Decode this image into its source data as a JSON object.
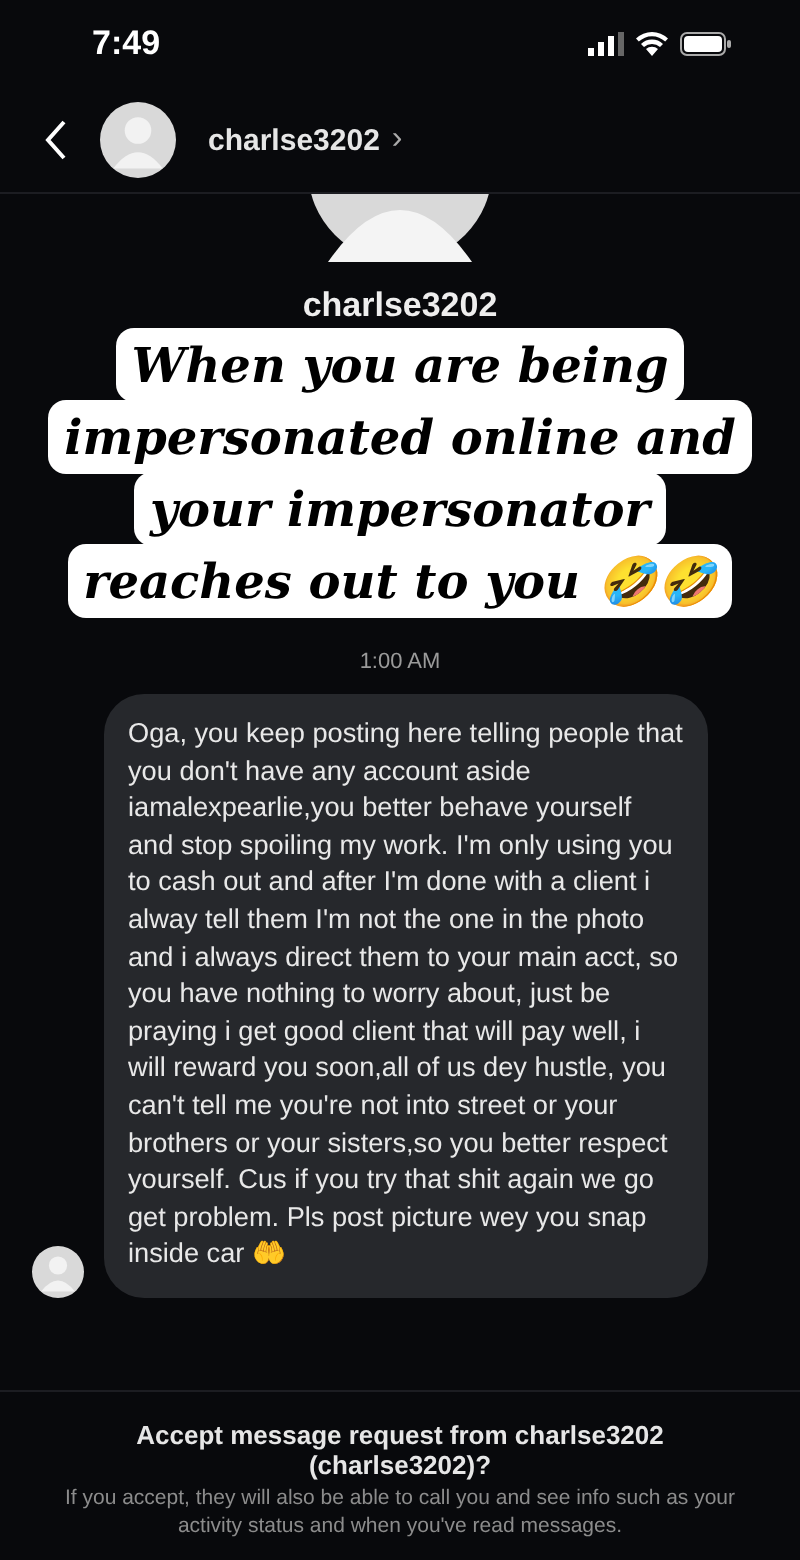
{
  "status_bar": {
    "time": "7:49"
  },
  "header": {
    "username": "charlse3202",
    "chevron": "›"
  },
  "profile": {
    "username": "charlse3202"
  },
  "caption": {
    "lines": [
      "When you are being",
      "impersonated online and",
      "your impersonator",
      "reaches out to you 🤣🤣"
    ]
  },
  "timestamp": "1:00 AM",
  "message": {
    "text": "Oga, you keep posting here telling people that you don't have any account aside iamalexpearlie,you better behave yourself and stop spoiling my work. I'm only using you to cash out and after I'm done with a client i alway tell them I'm not the one in the photo and i always direct them to your main acct, so you have nothing to worry about, just be praying i get good client that will pay well, i will reward you soon,all of us dey hustle, you can't tell me you're not into street or your brothers or your sisters,so you better respect yourself. Cus if you try that shit again we go get problem. Pls post picture wey you snap inside car 🤲"
  },
  "request": {
    "title": "Accept message request from charlse3202 (charlse3202)?",
    "description": "If you accept, they will also be able to call you and see info such as your activity status and when you've read messages."
  }
}
